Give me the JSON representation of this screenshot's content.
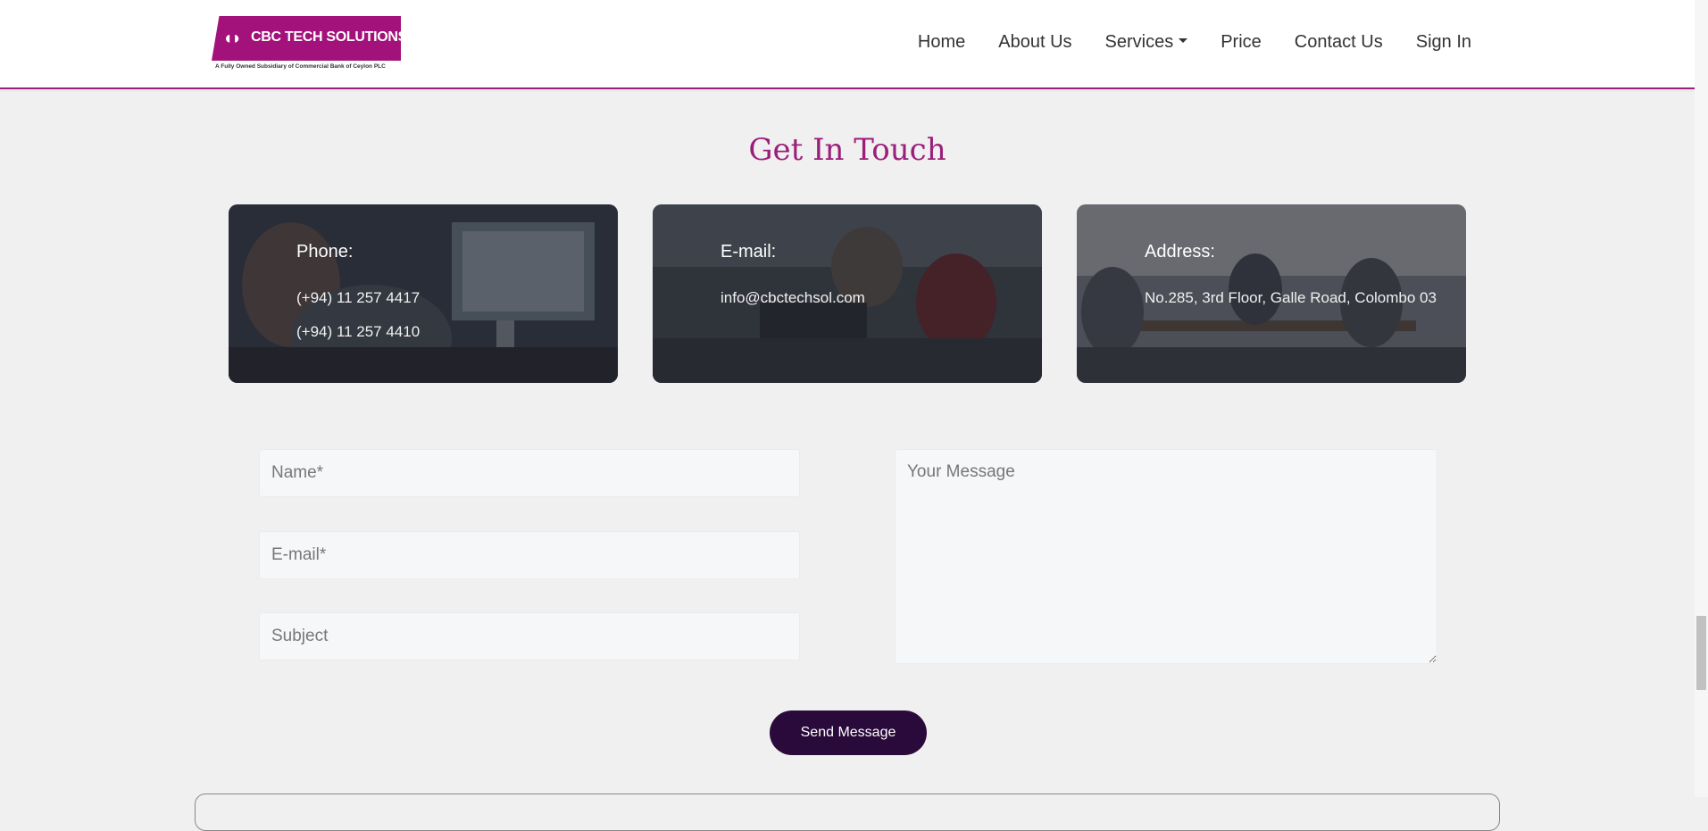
{
  "header": {
    "logo": {
      "name": "CBC TECH SOLUTIONS",
      "tagline": "A Fully Owned Subsidiary of Commercial Bank of Ceylon PLC"
    },
    "nav": [
      {
        "label": "Home"
      },
      {
        "label": "About Us"
      },
      {
        "label": "Services"
      },
      {
        "label": "Price"
      },
      {
        "label": "Contact Us"
      },
      {
        "label": "Sign In"
      }
    ]
  },
  "contact": {
    "title": "Get In Touch",
    "cards": {
      "phone": {
        "label": "Phone:",
        "lines": [
          "(+94) 11 257 4417",
          "(+94) 11 257 4410"
        ]
      },
      "email": {
        "label": "E-mail:",
        "lines": [
          "info@cbctechsol.com"
        ]
      },
      "address": {
        "label": "Address:",
        "lines": [
          "No.285, 3rd Floor, Galle Road, Colombo 03"
        ]
      }
    }
  },
  "form": {
    "name_placeholder": "Name*",
    "email_placeholder": "E-mail*",
    "subject_placeholder": "Subject",
    "message_placeholder": "Your Message",
    "submit_label": "Send Message"
  },
  "colors": {
    "brand": "#9b1f7a",
    "button": "#2a0a3a",
    "background": "#f0f0f0"
  }
}
